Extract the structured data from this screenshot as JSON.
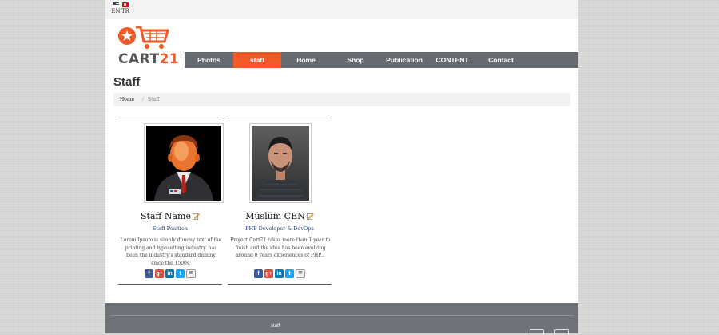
{
  "languages": [
    {
      "code": "EN"
    },
    {
      "code": "TR"
    }
  ],
  "logo": {
    "text_main": "CART",
    "text_accent": "21"
  },
  "nav": {
    "items": [
      {
        "label": "Photos",
        "active": false
      },
      {
        "label": "staff",
        "active": true
      },
      {
        "label": "Home",
        "active": false
      },
      {
        "label": "Shop",
        "active": false
      },
      {
        "label": "Publication",
        "active": false
      },
      {
        "label": "CONTENT",
        "active": false
      },
      {
        "label": "Contact",
        "active": false
      }
    ]
  },
  "page": {
    "title": "Staff"
  },
  "breadcrumb": {
    "home": "Home",
    "separator": "/",
    "current": "Staff"
  },
  "staff": [
    {
      "name": "Staff Name",
      "position": "Staff Position",
      "bio": "Lorem Ipsum is simply dummy text of the printing and typesetting industry. has been the industry's standard dummy since the 1500s,",
      "photo": "placeholder-avatar-icon"
    },
    {
      "name": "Müslüm ÇEN",
      "position": "PHP Developer & DevOps",
      "bio": "Project Cart21 takes more than 1 year to finish and the idea has been evolving around 8 years experiences of PHP...",
      "photo": "person-portrait"
    }
  ],
  "socials": [
    {
      "icon": "facebook-icon",
      "glyph": "f"
    },
    {
      "icon": "google-plus-icon",
      "glyph": "g+"
    },
    {
      "icon": "linkedin-icon",
      "glyph": "in"
    },
    {
      "icon": "twitter-icon",
      "glyph": "t"
    },
    {
      "icon": "message-icon",
      "glyph": "✉"
    }
  ],
  "footer": {
    "text": "staff"
  },
  "colors": {
    "accent": "#ef5a28",
    "nav_bg": "#656b70",
    "footer_bg": "#6d7378",
    "position_text": "#1c3d7a"
  }
}
